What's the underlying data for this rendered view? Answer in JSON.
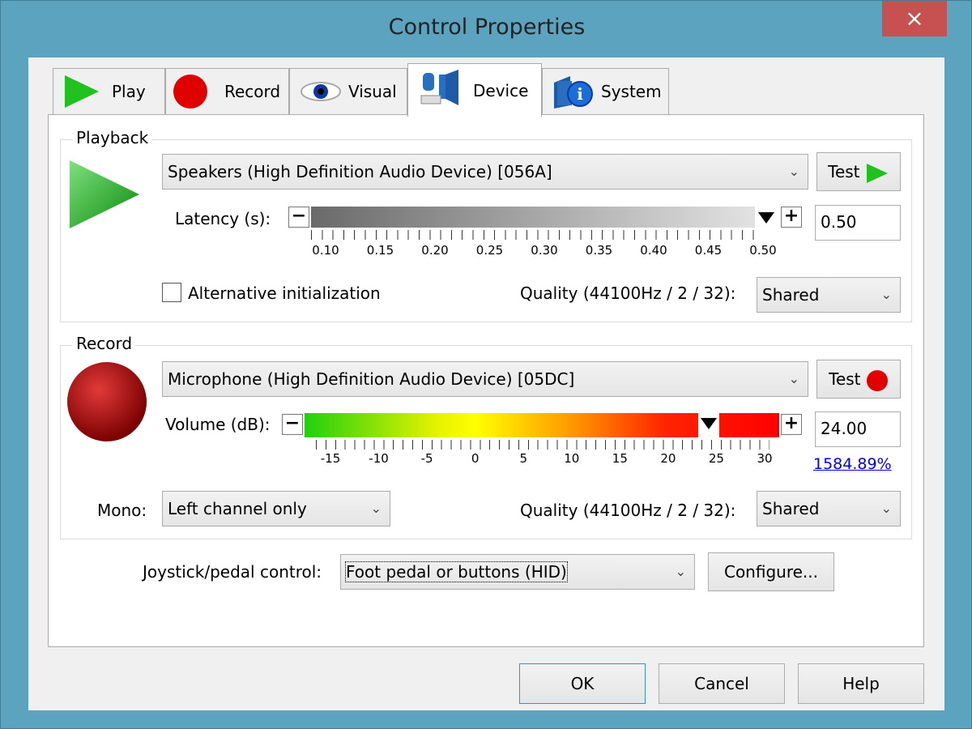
{
  "window": {
    "title": "Control Properties",
    "close": "×"
  },
  "tabs": [
    {
      "label": "Play",
      "icon": "play-triangle-green"
    },
    {
      "label": "Record",
      "icon": "record-circle-red"
    },
    {
      "label": "Visual",
      "icon": "eye"
    },
    {
      "label": "Device",
      "icon": "device-connectors"
    },
    {
      "label": "System",
      "icon": "info-cube"
    }
  ],
  "active_tab": "Device",
  "playback": {
    "group_label": "Playback",
    "device": "Speakers (High Definition Audio Device) [056A]",
    "test_label": "Test",
    "latency_label": "Latency (s):",
    "latency_value": "0.50",
    "latency_ticks": [
      "0.10",
      "0.15",
      "0.20",
      "0.25",
      "0.30",
      "0.35",
      "0.40",
      "0.45",
      "0.50"
    ],
    "alt_init_label": "Alternative initialization",
    "alt_init_checked": false,
    "quality_label": "Quality (44100Hz / 2 / 32):",
    "quality_value": "Shared"
  },
  "record": {
    "group_label": "Record",
    "device": "Microphone (High Definition Audio Device) [05DC]",
    "test_label": "Test",
    "volume_label": "Volume (dB):",
    "volume_value": "24.00",
    "volume_percent": "1584.89%",
    "volume_ticks": [
      "-15",
      "-10",
      "-5",
      "0",
      "5",
      "10",
      "15",
      "20",
      "25",
      "30"
    ],
    "mono_label": "Mono:",
    "mono_value": "Left channel only",
    "quality_label": "Quality (44100Hz / 2 / 32):",
    "quality_value": "Shared"
  },
  "joystick": {
    "label": "Joystick/pedal control:",
    "value": "Foot pedal or buttons (HID)",
    "configure_label": "Configure..."
  },
  "buttons": {
    "ok": "OK",
    "cancel": "Cancel",
    "help": "Help"
  },
  "colors": {
    "accent": "#5ba3be",
    "close": "#c75050",
    "link": "#0000ee"
  }
}
